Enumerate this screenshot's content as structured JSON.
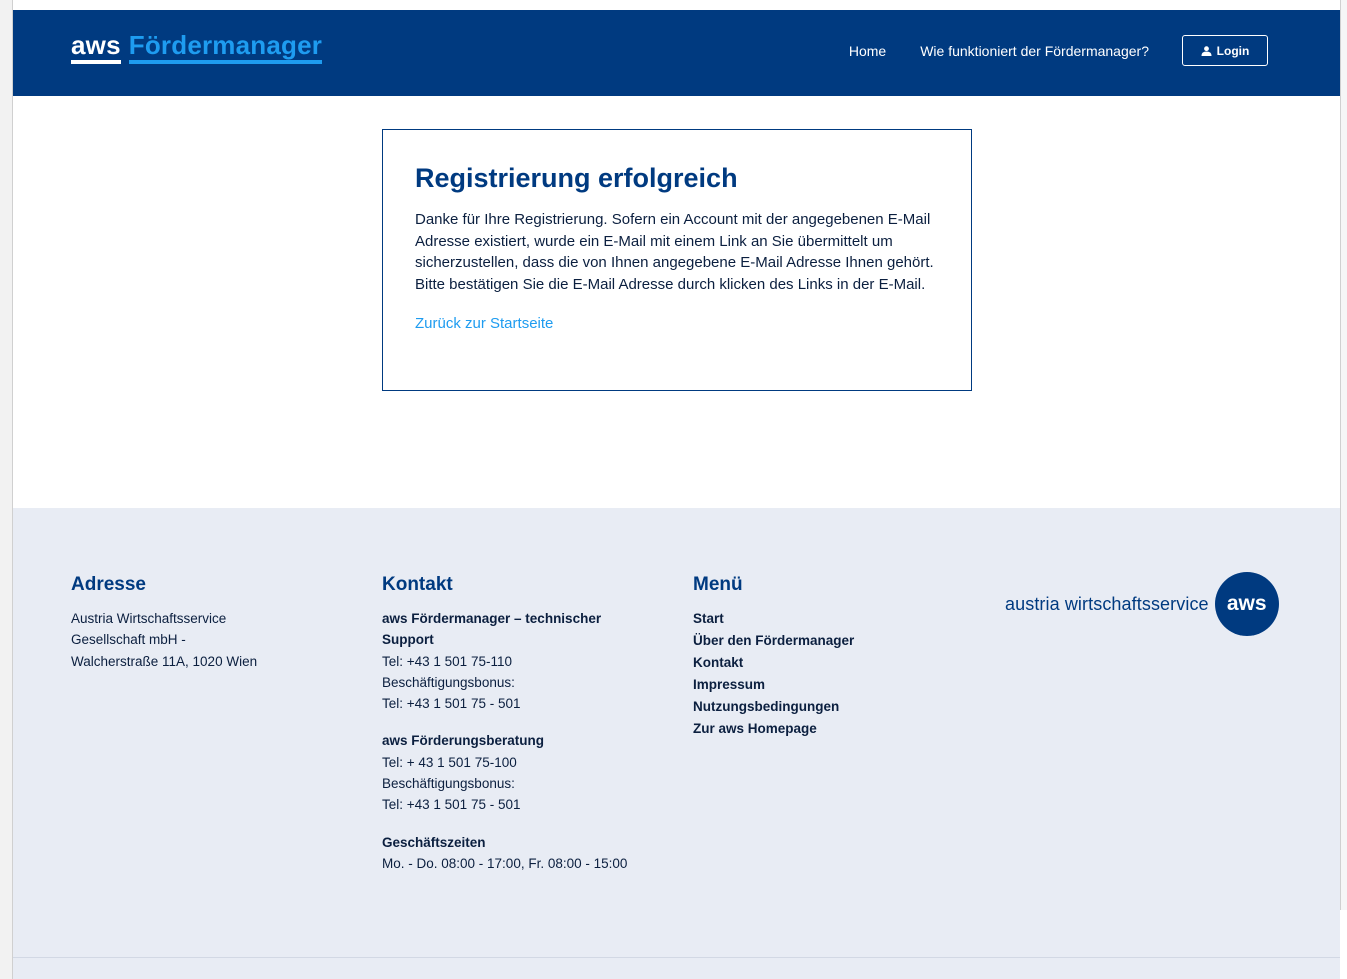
{
  "header": {
    "brand_aws": "aws",
    "brand_name": "Fördermanager",
    "nav": {
      "home": "Home",
      "how_it_works": "Wie funktioniert der Fördermanager?",
      "login": "Login"
    }
  },
  "main": {
    "title": "Registrierung erfolgreich",
    "message": "Danke für Ihre Registrierung. Sofern ein Account mit der angegebenen E-Mail Adresse existiert, wurde ein E-Mail mit einem Link an Sie übermittelt um sicherzustellen, dass die von Ihnen angegebene E-Mail Adresse Ihnen gehört. Bitte bestätigen Sie die E-Mail Adresse durch klicken des Links in der E-Mail.",
    "back_link": "Zurück zur Startseite"
  },
  "footer": {
    "address": {
      "heading": "Adresse",
      "line1": "Austria Wirtschaftsservice",
      "line2": "Gesellschaft mbH -",
      "line3": "Walcherstraße 11A, 1020 Wien"
    },
    "contact": {
      "heading": "Kontakt",
      "support_title": "aws Fördermanager – technischer Support",
      "support_tel": "Tel: +43 1 501 75-110",
      "support_bonus_label": "Beschäftigungsbonus:",
      "support_bonus_tel": "Tel: +43 1 501 75 - 501",
      "advice_title": "aws Förderungsberatung",
      "advice_tel": "Tel: + 43 1 501 75-100",
      "advice_bonus_label": "Beschäftigungsbonus:",
      "advice_bonus_tel": "Tel: +43 1 501 75 - 501",
      "hours_title": "Geschäftszeiten",
      "hours": "Mo. - Do. 08:00 - 17:00, Fr. 08:00 - 15:00"
    },
    "menu": {
      "heading": "Menü",
      "items": [
        "Start",
        "Über den Fördermanager",
        "Kontakt",
        "Impressum",
        "Nutzungsbedingungen",
        "Zur aws Homepage"
      ]
    },
    "logo": {
      "text": "austria wirtschaftsservice",
      "badge": "aws"
    }
  },
  "colors": {
    "primary": "#003a80",
    "accent": "#1e9cf0",
    "footer_bg": "#e8ecf4"
  },
  "icons": {
    "login": "user-icon"
  }
}
